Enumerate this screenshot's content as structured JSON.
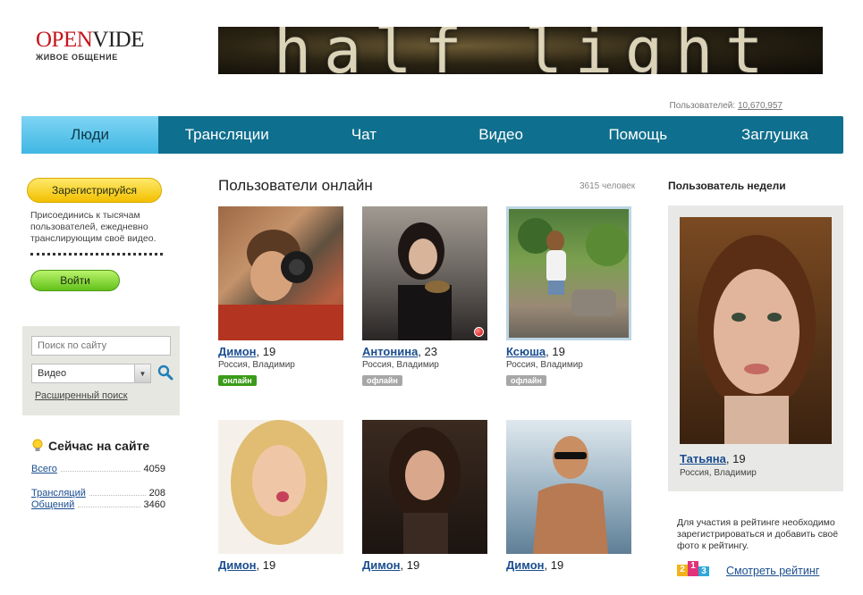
{
  "brand": {
    "logo_part1": "OPEN",
    "logo_part2": "VIDE",
    "tagline": "ЖИВОЕ ОБЩЕНИЕ",
    "banner_text": "half light"
  },
  "users_total": {
    "label": "Пользователей:",
    "value": "10,670,957"
  },
  "nav": {
    "items": [
      {
        "label": "Люди",
        "active": true
      },
      {
        "label": "Трансляции"
      },
      {
        "label": "Чат"
      },
      {
        "label": "Видео"
      },
      {
        "label": "Помощь"
      },
      {
        "label": "Заглушка"
      }
    ]
  },
  "left": {
    "register_label": "Зарегистрируйся",
    "join_text": "Присоединись к тысячам пользователей, ежедневно транслирующим своё видео.",
    "login_label": "Войти",
    "search": {
      "placeholder": "Поиск по сайту",
      "select_value": "Видео",
      "advanced_label": "Расширенный поиск"
    },
    "now_title": "Сейчас на сайте",
    "stats": [
      {
        "label": "Всего",
        "value": "4059"
      },
      {
        "label": "Трансляций",
        "value": "208"
      },
      {
        "label": "Общений",
        "value": "3460"
      }
    ]
  },
  "center": {
    "title": "Пользователи онлайн",
    "count": "3615 человек",
    "users": [
      {
        "name": "Димон",
        "age": ", 19",
        "location": "Россия, Владимир",
        "status": "онлайн"
      },
      {
        "name": "Антонина",
        "age": ", 23",
        "location": "Россия, Владимир",
        "status": "офлайн"
      },
      {
        "name": "Ксюша",
        "age": ", 19",
        "location": "Россия, Владимир",
        "status": "офлайн"
      },
      {
        "name": "Димон",
        "age": ", 19",
        "location": "",
        "status": ""
      },
      {
        "name": "Димон",
        "age": ", 19",
        "location": "",
        "status": ""
      },
      {
        "name": "Димон",
        "age": ", 19",
        "location": "",
        "status": ""
      }
    ]
  },
  "right": {
    "title": "Пользователь недели",
    "name": "Татьяна",
    "age": ", 19",
    "location": "Россия, Владимир",
    "rating_text": "Для участия в рейтинге необходимо зарегистрироваться и добавить своё фото к рейтингу.",
    "rating_icons": [
      "2",
      "1",
      "3"
    ],
    "rating_link": "Смотреть рейтинг"
  },
  "colors": {
    "nav_bg": "#0f6f8e",
    "nav_active": "#3fb7e3",
    "link": "#1a4d8f",
    "online": "#3b9b19",
    "offline": "#a7a7a7"
  }
}
